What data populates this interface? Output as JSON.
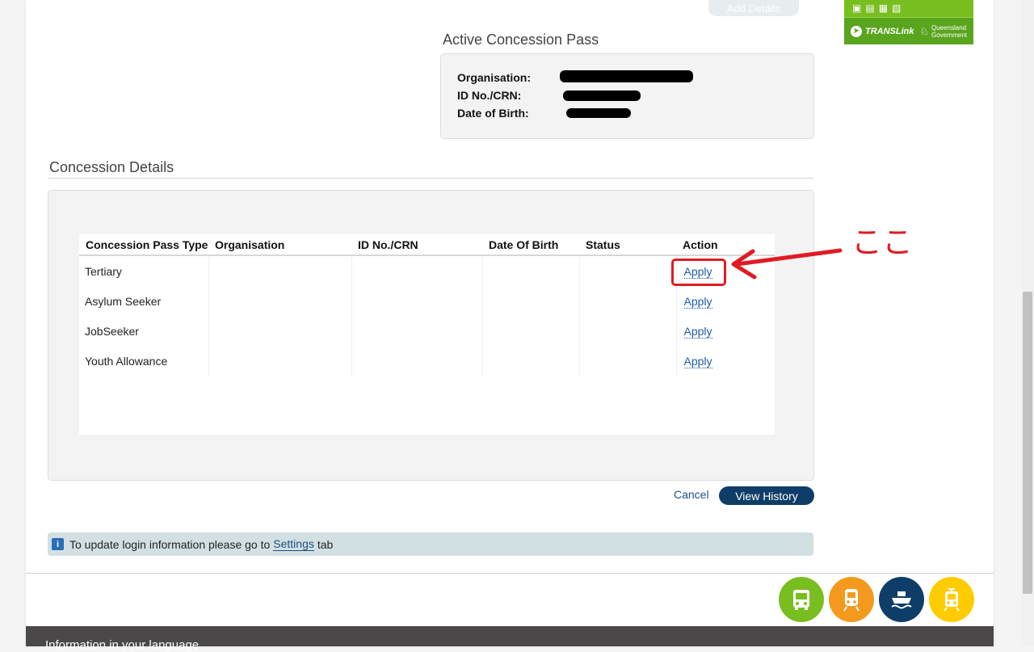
{
  "top": {
    "add_details_label": "Add Details"
  },
  "brand": {
    "transport_glyphs": [
      "bus-icon",
      "train-icon",
      "ferry-icon",
      "tram-icon"
    ],
    "name": "TRANSLink",
    "gov_line1": "Queensland",
    "gov_line2": "Government",
    "color_primary": "#78be20",
    "color_secondary": "#5aa51e"
  },
  "active_pass": {
    "title": "Active Concession Pass",
    "org_label": "Organisation:",
    "id_label": "ID No./CRN:",
    "dob_label": "Date of Birth:"
  },
  "details": {
    "title": "Concession Details",
    "columns": [
      "Concession Pass Type",
      "Organisation",
      "ID No./CRN",
      "Date Of Birth",
      "Status",
      "Action"
    ],
    "rows": [
      {
        "type": "Tertiary",
        "organisation": "",
        "id": "",
        "dob": "",
        "status": "",
        "action": "Apply"
      },
      {
        "type": "Asylum Seeker",
        "organisation": "",
        "id": "",
        "dob": "",
        "status": "",
        "action": "Apply"
      },
      {
        "type": "JobSeeker",
        "organisation": "",
        "id": "",
        "dob": "",
        "status": "",
        "action": "Apply"
      },
      {
        "type": "Youth Allowance",
        "organisation": "",
        "id": "",
        "dob": "",
        "status": "",
        "action": "Apply"
      }
    ]
  },
  "annotation": {
    "text": "ここ",
    "color": "#e01b24"
  },
  "actions": {
    "cancel_label": "Cancel",
    "view_history_label": "View History"
  },
  "info": {
    "prefix": "To update login information please go to",
    "link": "Settings",
    "suffix": "tab"
  },
  "transport_icons": [
    {
      "name": "bus-icon",
      "color": "#78be20"
    },
    {
      "name": "train-icon",
      "color": "#f39a1e"
    },
    {
      "name": "ferry-icon",
      "color": "#0e3d67"
    },
    {
      "name": "tram-icon",
      "color": "#ffcc00"
    }
  ],
  "footer": {
    "language_label": "Information in your language"
  }
}
